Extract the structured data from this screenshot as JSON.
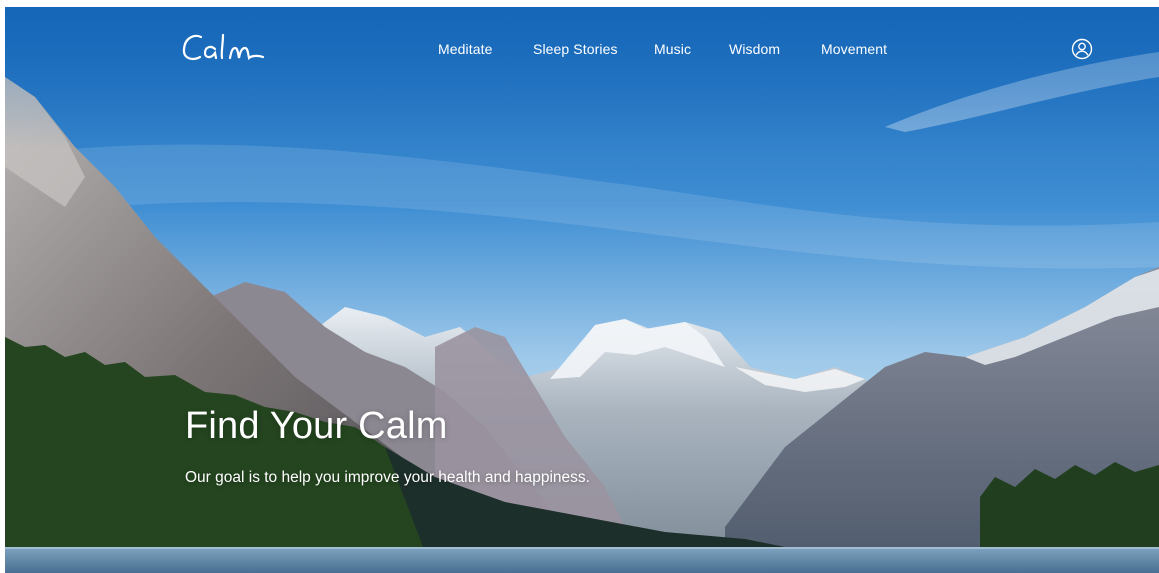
{
  "brand": {
    "logo_text": "Calm"
  },
  "nav": {
    "links": [
      "Meditate",
      "Sleep Stories",
      "Music",
      "Wisdom",
      "Movement"
    ]
  },
  "icons": {
    "profile": "user-circle-icon"
  },
  "hero": {
    "title": "Find Your Calm",
    "subtitle": "Our goal is to help you improve your health and happiness."
  },
  "colors": {
    "sky_top": "#1c6fc0",
    "sky_mid": "#5aa0d8",
    "text": "#ffffff",
    "forest": "#1f3a1c",
    "lake": "#5d87a8"
  }
}
